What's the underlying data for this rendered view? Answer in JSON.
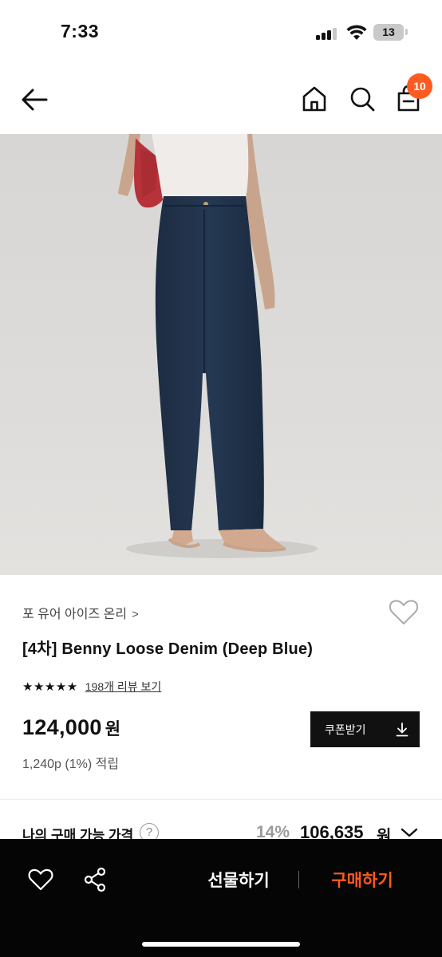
{
  "status_bar": {
    "time": "7:33",
    "battery": "13"
  },
  "nav": {
    "cart_count": "10",
    "icons": [
      "back-arrow-icon",
      "home-icon",
      "search-icon",
      "cart-icon"
    ]
  },
  "product": {
    "brand": "포 유어 아이즈 온리",
    "brand_chevron": ">",
    "title": "[4차] Benny Loose Denim (Deep Blue)",
    "stars": "★★★★★",
    "rating": 5,
    "review_link": "198개 리뷰 보기",
    "price": "124,000",
    "price_unit": "원",
    "points": "1,240p (1%) 적립"
  },
  "coupon": {
    "label": "쿠폰받기"
  },
  "my_price": {
    "label": "나의 구매 가능 가격",
    "help": "?",
    "discount": "14%",
    "value": "106,635",
    "unit": "원"
  },
  "bottom_bar": {
    "gift_label": "선물하기",
    "buy_label": "구매하기"
  },
  "colors": {
    "accent": "#ff5a1f",
    "dark": "#050505",
    "badge": "#ff5a1f"
  }
}
